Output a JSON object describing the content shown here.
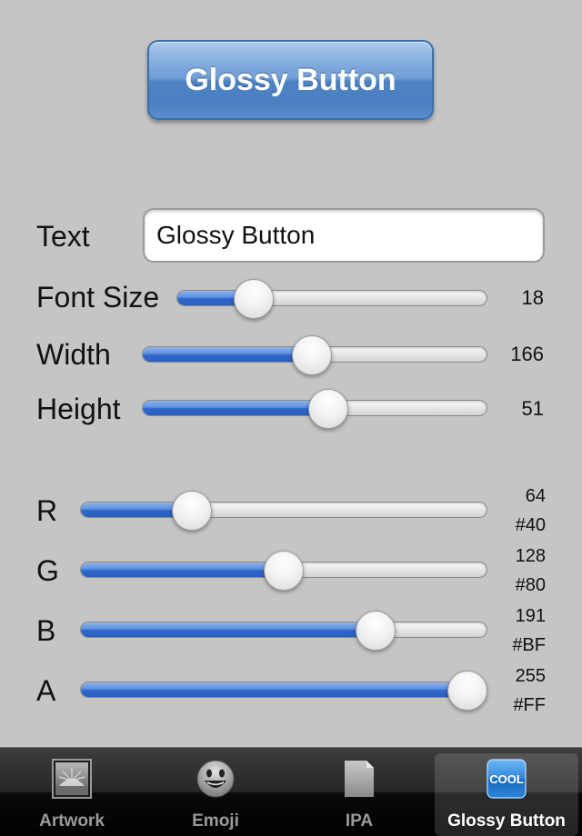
{
  "preview": {
    "label": "Glossy Button"
  },
  "controls": {
    "text": {
      "label": "Text",
      "value": "Glossy Button"
    },
    "font_size": {
      "label": "Font Size",
      "value": "18",
      "fill": 0.21
    },
    "width": {
      "label": "Width",
      "value": "166",
      "fill": 0.49
    },
    "height": {
      "label": "Height",
      "value": "51",
      "fill": 0.545
    }
  },
  "color": {
    "r": {
      "label": "R",
      "value": "64",
      "hex": "#40",
      "fill": 0.25
    },
    "g": {
      "label": "G",
      "value": "128",
      "hex": "#80",
      "fill": 0.5
    },
    "b": {
      "label": "B",
      "value": "191",
      "hex": "#BF",
      "fill": 0.75
    },
    "a": {
      "label": "A",
      "value": "255",
      "hex": "#FF",
      "fill": 1.0
    }
  },
  "tabbar": {
    "tabs": [
      {
        "label": "Artwork",
        "icon": "artwork-icon",
        "active": false
      },
      {
        "label": "Emoji",
        "icon": "emoji-icon",
        "active": false
      },
      {
        "label": "IPA",
        "icon": "ipa-document-icon",
        "active": false
      },
      {
        "label": "Glossy Button",
        "icon": "cool-button-icon",
        "active": true,
        "icon_text": "COOL"
      }
    ]
  },
  "colors": {
    "button_blue": "#4a80c2",
    "slider_fill": "#2f67c9",
    "background": "#c5c5c5"
  }
}
